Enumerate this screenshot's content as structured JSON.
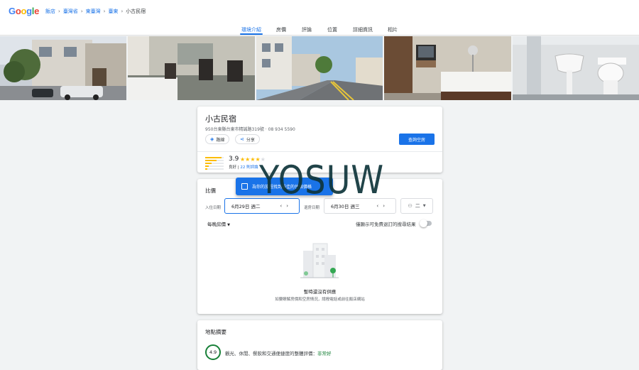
{
  "header": {
    "logo": "Google",
    "breadcrumbs": [
      {
        "label": "飯店"
      },
      {
        "label": "臺灣省"
      },
      {
        "label": "東臺灣"
      },
      {
        "label": "臺東"
      },
      {
        "label": "小古民宿"
      }
    ],
    "separator": "›"
  },
  "tabs": [
    {
      "label": "環境介紹",
      "active": true
    },
    {
      "label": "房價"
    },
    {
      "label": "評論"
    },
    {
      "label": "位置"
    },
    {
      "label": "詳細資訊"
    },
    {
      "label": "相片"
    }
  ],
  "photos": [
    {
      "subject": "street-exterior"
    },
    {
      "subject": "bedroom-chairs"
    },
    {
      "subject": "street-view"
    },
    {
      "subject": "bedroom-bed"
    },
    {
      "subject": "bathroom"
    }
  ],
  "hotel": {
    "name": "小古民宿",
    "address": "950台東縣台東市精誠路319號 · 08 934 5590",
    "route_label": "路線",
    "share_label": "分享",
    "check_rooms_label": "查詢空房",
    "rating": "3.9",
    "stars": 4,
    "rating_word": "良好",
    "review_count": "22 則評論",
    "rating_distribution": [
      0.9,
      0.6,
      0.35,
      0.2,
      0.1
    ]
  },
  "prices": {
    "section_title": "比價",
    "toast_text": "為你的旅程找到最佳的住宿價格",
    "checkin_label": "入住日期",
    "checkin_value": "6月29日 週二",
    "checkout_label": "退房日期",
    "checkout_value": "6月30日 週三",
    "guests_value": "二",
    "per_night_label": "每晚房價",
    "toggle_label": "僅顯示可免費退訂的搜尋結果",
    "empty_title": "暫時還沒有供應",
    "empty_subtitle": "如要瞭解房價和空房情況，請撥電話或前往飯店網站"
  },
  "area": {
    "title": "地點摘要",
    "score": "4.9",
    "summary": "觀光、休閒、餐飲和交通便捷度的整體評價：",
    "verdict": "非常好"
  },
  "watermark": "YOSUW",
  "colors": {
    "accent": "#1a73e8",
    "star": "#fbbc04",
    "good": "#188038"
  }
}
